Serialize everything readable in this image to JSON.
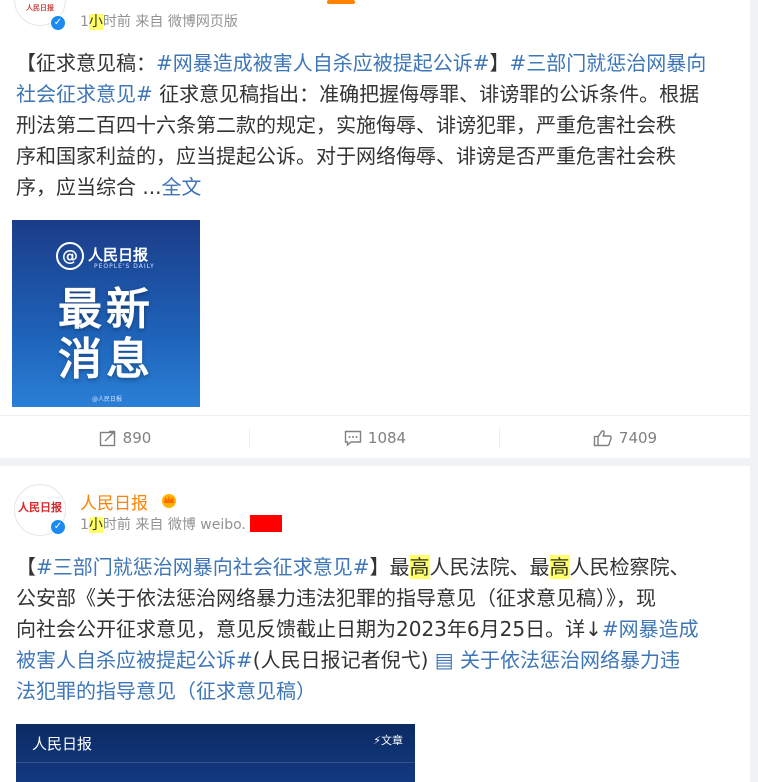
{
  "post1": {
    "meta_time_prefix": "1",
    "meta_time_highlight": "小",
    "meta_time_suffix": "时前 来自 微博网页版",
    "text_lines": [
      {
        "parts": [
          {
            "t": "【征求意见稿：",
            "link": false
          },
          {
            "t": "#网暴造成被害人自杀应被提起公诉#",
            "link": true
          },
          {
            "t": "】",
            "link": false
          },
          {
            "t": "#三部门就惩治网暴向",
            "link": true
          }
        ]
      },
      {
        "parts": [
          {
            "t": "社会征求意见#",
            "link": true
          },
          {
            "t": " 征求意见稿指出：准确把握侮辱罪、诽谤罪的公诉条件。根据",
            "link": false
          }
        ]
      },
      {
        "parts": [
          {
            "t": "刑法第二百四十六条第二款的规定，实施侮辱、诽谤犯罪，严重危害社会秩",
            "link": false
          }
        ]
      },
      {
        "parts": [
          {
            "t": "序和国家利益的，应当提起公诉。对于网络侮辱、诽谤是否严重危害社会秩",
            "link": false
          }
        ]
      },
      {
        "parts": [
          {
            "t": "序，应当综合 ...",
            "link": false
          },
          {
            "t": "全文",
            "link": true
          }
        ]
      }
    ],
    "image": {
      "brand": "人民日报",
      "brand_en": "PEOPLE'S DAILY",
      "line1": "最新",
      "line2": "消息",
      "watermark": "@人民日报"
    },
    "actions": {
      "repost_count": "890",
      "comment_count": "1084",
      "like_count": "7409"
    }
  },
  "post2": {
    "author": "人民日报",
    "avatar_text": "人民日报",
    "meta_time_prefix": "1",
    "meta_time_highlight": "小",
    "meta_time_suffix": "时前 来自 微博 weibo.",
    "text_lines": [
      {
        "parts": [
          {
            "t": "【",
            "link": false
          },
          {
            "t": "#三部门就惩治网暴向社会征求意见#",
            "link": true
          },
          {
            "t": "】最",
            "link": false
          },
          {
            "t": "高",
            "hl": true
          },
          {
            "t": "人民法院、最",
            "link": false
          },
          {
            "t": "高",
            "hl": true
          },
          {
            "t": "人民检察院、",
            "link": false
          }
        ]
      },
      {
        "parts": [
          {
            "t": "公安部《关于依法惩治网络暴力违法犯罪的指导意见（征求意见稿）》，现",
            "link": false
          }
        ]
      },
      {
        "parts": [
          {
            "t": "向社会公开征求意见，意见反馈截止日期为2023年6月25日。详↓",
            "link": false
          },
          {
            "t": "#网暴造成",
            "link": true
          }
        ]
      },
      {
        "parts": [
          {
            "t": "被害人自杀应被提起公诉#",
            "link": true
          },
          {
            "t": "(人民日报记者倪弋) ",
            "link": false
          },
          {
            "t": "▤ 关于依法惩治网络暴力违",
            "link": true
          }
        ]
      },
      {
        "parts": [
          {
            "t": "法犯罪的指导意见（征求意见稿）",
            "link": true
          }
        ]
      }
    ],
    "preview": {
      "title": "人民日报",
      "tag": "⚡文章"
    }
  },
  "colors": {
    "accent": "#ff8200",
    "link": "#3e76b7",
    "highlight": "#ffff66",
    "verified": "#1a8cf0"
  }
}
